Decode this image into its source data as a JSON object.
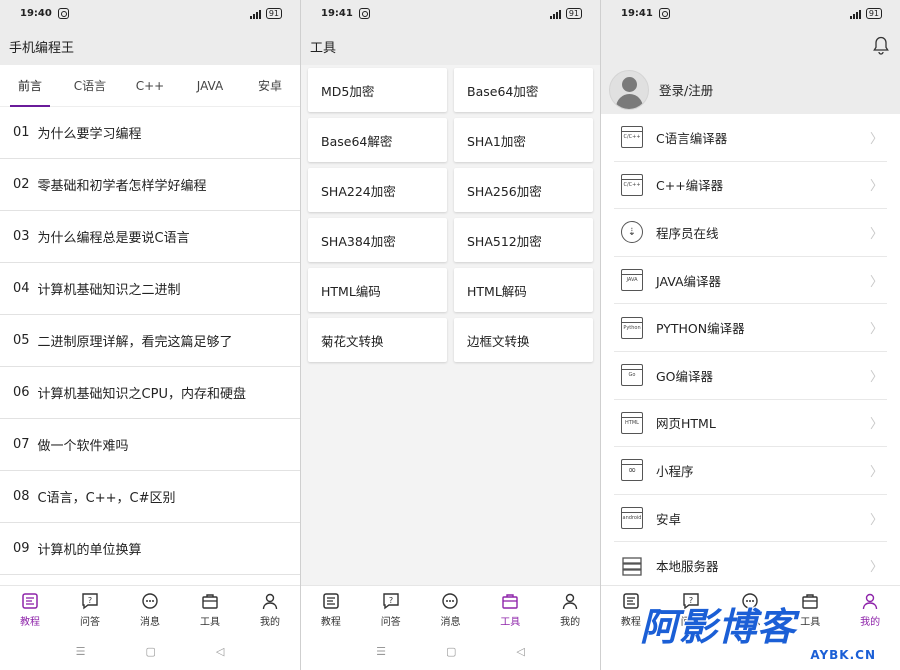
{
  "phone1": {
    "status_time": "19:40",
    "battery": "91",
    "title": "手机编程王",
    "tabs": [
      "前言",
      "C语言",
      "C++",
      "JAVA",
      "安卓"
    ],
    "lessons": [
      {
        "num": "01",
        "title": "为什么要学习编程"
      },
      {
        "num": "02",
        "title": "零基础和初学者怎样学好编程"
      },
      {
        "num": "03",
        "title": "为什么编程总是要说C语言"
      },
      {
        "num": "04",
        "title": "计算机基础知识之二进制"
      },
      {
        "num": "05",
        "title": "二进制原理详解，看完这篇足够了"
      },
      {
        "num": "06",
        "title": "计算机基础知识之CPU，内存和硬盘"
      },
      {
        "num": "07",
        "title": "做一个软件难吗"
      },
      {
        "num": "08",
        "title": "C语言，C++，C#区别"
      },
      {
        "num": "09",
        "title": "计算机的单位换算"
      }
    ]
  },
  "phone2": {
    "status_time": "19:41",
    "battery": "91",
    "title": "工具",
    "tools": [
      "MD5加密",
      "Base64加密",
      "Base64解密",
      "SHA1加密",
      "SHA224加密",
      "SHA256加密",
      "SHA384加密",
      "SHA512加密",
      "HTML编码",
      "HTML解码",
      "菊花文转换",
      "边框文转换"
    ]
  },
  "phone3": {
    "status_time": "19:41",
    "battery": "91",
    "login_label": "登录/注册",
    "menu": [
      {
        "label": "C语言编译器",
        "icon_text": "C/C++"
      },
      {
        "label": "C++编译器",
        "icon_text": "C/C++"
      },
      {
        "label": "程序员在线",
        "icon_text": ""
      },
      {
        "label": "JAVA编译器",
        "icon_text": "JAVA"
      },
      {
        "label": "PYTHON编译器",
        "icon_text": "Python"
      },
      {
        "label": "GO编译器",
        "icon_text": "Go"
      },
      {
        "label": "网页HTML",
        "icon_text": "HTML"
      },
      {
        "label": "小程序",
        "icon_text": "∞"
      },
      {
        "label": "安卓",
        "icon_text": "android"
      },
      {
        "label": "本地服务器",
        "icon_text": ""
      }
    ]
  },
  "nav": [
    "教程",
    "问答",
    "消息",
    "工具",
    "我的"
  ],
  "watermark": {
    "main": "阿影博客",
    "sub": "AYBK.CN"
  },
  "colors": {
    "accent": "#8e24aa",
    "watermark": "#1b5fd6"
  }
}
